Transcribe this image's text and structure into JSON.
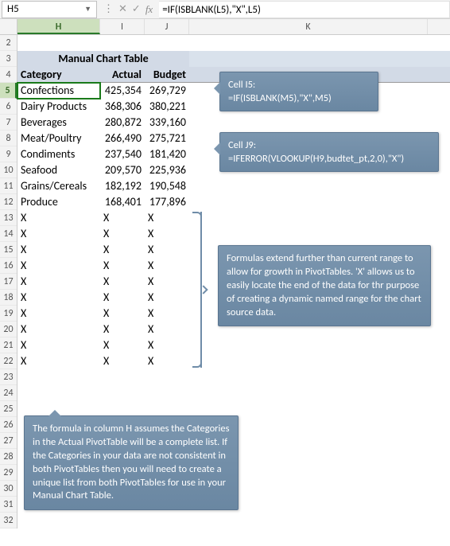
{
  "name_box": "H5",
  "formula_bar": "=IF(ISBLANK(L5),\"X\",L5)",
  "columns": {
    "H": "H",
    "I": "I",
    "J": "J",
    "K": "K"
  },
  "row_numbers": [
    "2",
    "3",
    "4",
    "5",
    "6",
    "7",
    "8",
    "9",
    "10",
    "11",
    "12",
    "13",
    "14",
    "15",
    "16",
    "17",
    "18",
    "19",
    "20",
    "21",
    "22",
    "23",
    "24",
    "25",
    "26",
    "27",
    "28",
    "29",
    "30",
    "31",
    "32"
  ],
  "title": "Manual Chart Table",
  "headers": {
    "category": "Category",
    "actual": "Actual",
    "budget": "Budget"
  },
  "selected_row": "5",
  "rows": [
    {
      "category": "Confections",
      "actual": "425,354",
      "budget": "269,729"
    },
    {
      "category": "Dairy Products",
      "actual": "368,306",
      "budget": "380,221"
    },
    {
      "category": "Beverages",
      "actual": "280,872",
      "budget": "339,160"
    },
    {
      "category": "Meat/Poultry",
      "actual": "266,490",
      "budget": "275,721"
    },
    {
      "category": "Condiments",
      "actual": "237,540",
      "budget": "181,420"
    },
    {
      "category": "Seafood",
      "actual": "209,570",
      "budget": "225,936"
    },
    {
      "category": "Grains/Cereals",
      "actual": "182,192",
      "budget": "190,548"
    },
    {
      "category": "Produce",
      "actual": "168,401",
      "budget": "177,896"
    },
    {
      "category": "X",
      "actual": "X",
      "budget": "X"
    },
    {
      "category": "X",
      "actual": "X",
      "budget": "X"
    },
    {
      "category": "X",
      "actual": "X",
      "budget": "X"
    },
    {
      "category": "X",
      "actual": "X",
      "budget": "X"
    },
    {
      "category": "X",
      "actual": "X",
      "budget": "X"
    },
    {
      "category": "X",
      "actual": "X",
      "budget": "X"
    },
    {
      "category": "X",
      "actual": "X",
      "budget": "X"
    },
    {
      "category": "X",
      "actual": "X",
      "budget": "X"
    },
    {
      "category": "X",
      "actual": "X",
      "budget": "X"
    },
    {
      "category": "X",
      "actual": "X",
      "budget": "X"
    }
  ],
  "callouts": {
    "i5": {
      "title": "Cell I5:",
      "formula": "=IF(ISBLANK(M5),\"X\",M5)"
    },
    "j9": {
      "title": "Cell J9:",
      "formula": "=IFERROR(VLOOKUP(H9,budtet_pt,2,0),\"X\")"
    },
    "growth": "Formulas extend further than current range to allow for growth in PivotTables. 'X' allows us to easily locate the end of the data for thr purpose of creating a dynamic named range for the chart source data.",
    "bottom": "The formula in column H assumes the Categories in the Actual PivotTable will be a complete list. If the Categories in your data are not consistent in both PivotTables then you will need to create a unique list from both PivotTables for use in your Manual Chart Table."
  },
  "x_align": {
    "I": "left",
    "J": "left"
  }
}
